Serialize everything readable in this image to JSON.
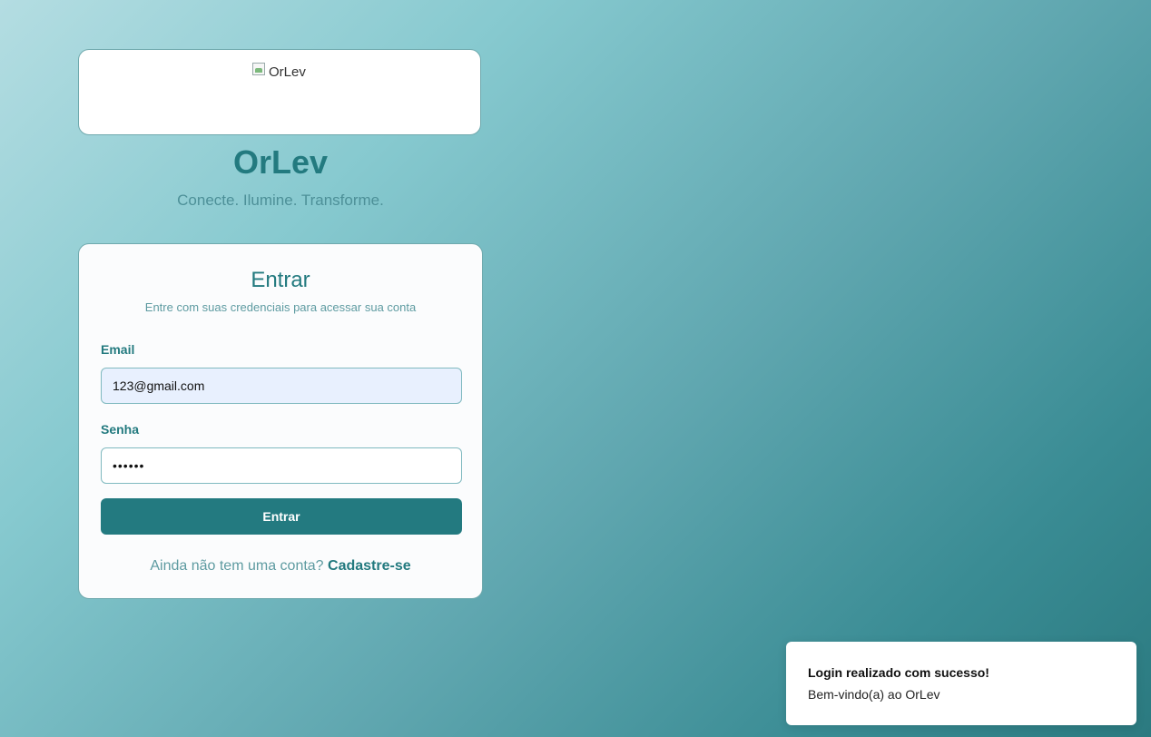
{
  "logo": {
    "alt_text": "OrLev"
  },
  "brand": {
    "title": "OrLev",
    "tagline": "Conecte. Ilumine. Transforme."
  },
  "login": {
    "title": "Entrar",
    "subtitle": "Entre com suas credenciais para acessar sua conta",
    "email_label": "Email",
    "email_value": "123@gmail.com",
    "password_label": "Senha",
    "password_value": "123456",
    "submit_label": "Entrar",
    "signup_prompt": "Ainda não tem uma conta?",
    "signup_link": "Cadastre-se"
  },
  "toast": {
    "title": "Login realizado com sucesso!",
    "message": "Bem-vindo(a) ao OrLev"
  },
  "colors": {
    "primary": "#237a80",
    "muted": "#5e9ba1",
    "input_autofill": "#e8f0fe"
  },
  "icons": {
    "logo": "broken-image-icon"
  }
}
